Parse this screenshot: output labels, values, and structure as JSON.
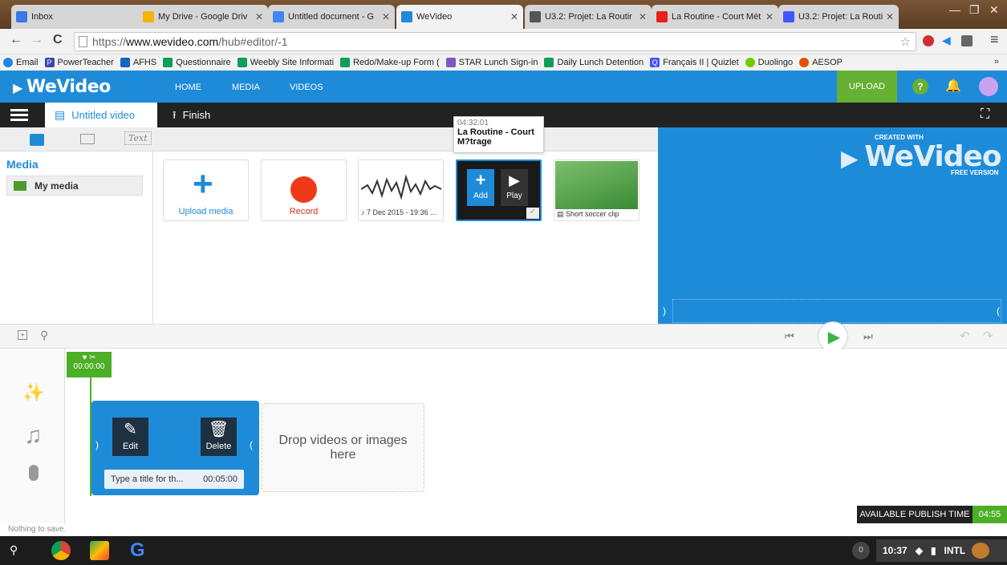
{
  "browser": {
    "tabs": [
      {
        "label": "Inbox",
        "color": "#3b78e7"
      },
      {
        "label": "My Drive - Google Driv",
        "color": "#f4b400"
      },
      {
        "label": "Untitled document - G",
        "color": "#4285f4"
      },
      {
        "label": "WeVideo",
        "color": "#1e8bd9",
        "active": true
      },
      {
        "label": "U3.2: Projet: La Routir",
        "color": "#555555"
      },
      {
        "label": "La Routine - Court Mét",
        "color": "#e62117"
      },
      {
        "label": "U3.2: Projet: La Routir",
        "color": "#4255ff"
      }
    ],
    "url_prefix": "https://",
    "url_host": "www.wevideo.com",
    "url_path": "/hub#editor/-1",
    "bookmarks": [
      {
        "label": "Email",
        "color": "#1e88e5"
      },
      {
        "label": "PowerTeacher",
        "color": "#3949ab"
      },
      {
        "label": "AFHS",
        "color": "#1565c0"
      },
      {
        "label": "Questionnaire",
        "color": "#0f9d58"
      },
      {
        "label": "Weebly Site Informati",
        "color": "#0f9d58"
      },
      {
        "label": "Redo/Make-up Form (",
        "color": "#0f9d58"
      },
      {
        "label": "STAR Lunch Sign-in",
        "color": "#7e57c2"
      },
      {
        "label": "Daily Lunch Detention",
        "color": "#0f9d58"
      },
      {
        "label": "Français II | Quizlet",
        "color": "#4255ff"
      },
      {
        "label": "Duolingo",
        "color": "#78c800"
      },
      {
        "label": "AESOP",
        "color": "#e65100"
      }
    ]
  },
  "app": {
    "logo": "WeVideo",
    "nav": [
      "HOME",
      "MEDIA",
      "VIDEOS"
    ],
    "upload": "UPLOAD",
    "project_title": "Untitled video",
    "finish": "Finish",
    "media_heading": "Media",
    "my_media": "My media",
    "text_tab": "Text",
    "tooltip": {
      "time": "04:32:01",
      "title": "La Routine - Court M?trage"
    },
    "thumbs": {
      "upload": "Upload media",
      "record": "Record",
      "audio": "7 Dec 2015 - 19:36 ...",
      "add": "Add",
      "play": "Play",
      "soccer": "Short soccer clip"
    },
    "preview_brand": "WeVideo",
    "preview_created": "CREATED WITH",
    "preview_free": "FREE VERSION",
    "playhead_time": "00:00:00",
    "clip": {
      "edit": "Edit",
      "delete": "Delete",
      "title": "Type a title for th...",
      "duration": "00:05:00"
    },
    "drop_text": "Drop videos or images here",
    "publish_label": "AVAILABLE PUBLISH TIME",
    "publish_time": "04:55",
    "status": "Nothing to save."
  },
  "shelf": {
    "notif": "0",
    "time": "10:37",
    "ime": "INTL"
  },
  "colors": {
    "brand": "#1e8bd9",
    "accent_green": "#66b033",
    "record_red": "#f03a17"
  }
}
